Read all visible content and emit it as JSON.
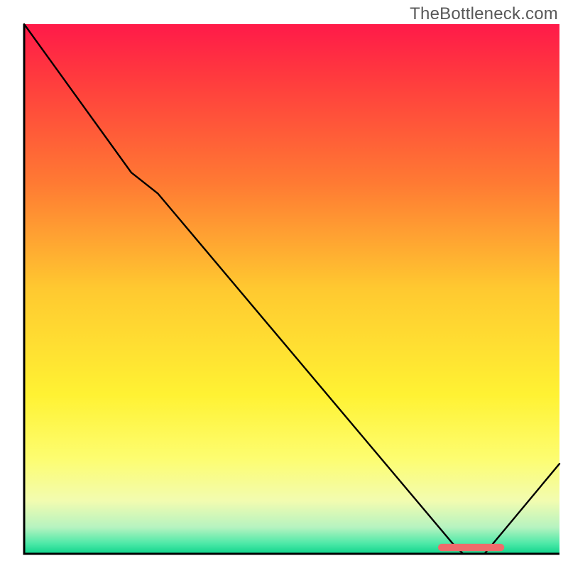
{
  "watermark": "TheBottleneck.com",
  "chart_data": {
    "type": "line",
    "title": "",
    "xlabel": "",
    "ylabel": "",
    "xlim": [
      0,
      100
    ],
    "ylim": [
      0,
      100
    ],
    "grid": false,
    "legend": false,
    "axes_visible": false,
    "background": {
      "type": "vertical-gradient",
      "stops": [
        {
          "pos": 0.0,
          "color": "#ff1a49"
        },
        {
          "pos": 0.1,
          "color": "#ff3a3e"
        },
        {
          "pos": 0.3,
          "color": "#ff7a33"
        },
        {
          "pos": 0.5,
          "color": "#ffc930"
        },
        {
          "pos": 0.7,
          "color": "#fff233"
        },
        {
          "pos": 0.82,
          "color": "#fdfd70"
        },
        {
          "pos": 0.9,
          "color": "#f2fcb0"
        },
        {
          "pos": 0.95,
          "color": "#b6f3c0"
        },
        {
          "pos": 0.98,
          "color": "#4fe9a8"
        },
        {
          "pos": 1.0,
          "color": "#0fd48c"
        }
      ]
    },
    "series": [
      {
        "name": "curve",
        "color": "#000000",
        "x": [
          0,
          5,
          20,
          25,
          80,
          82,
          86,
          100
        ],
        "y": [
          100,
          93,
          72,
          68,
          2,
          0,
          0,
          17
        ]
      }
    ],
    "marker": {
      "name": "highlight-segment",
      "color": "#ef6b6b",
      "y": 1.2,
      "x_start": 78,
      "x_end": 89,
      "thickness": 1.4
    }
  }
}
